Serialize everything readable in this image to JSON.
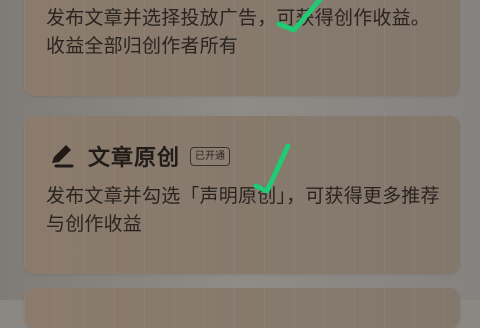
{
  "cards": {
    "top": {
      "description": "发布文章并选择投放广告，可获得创作收益。收益全部归创作者所有"
    },
    "original": {
      "title": "文章原创",
      "badge": "已开通",
      "description": "发布文章并勾选「声明原创」，可获得更多推荐与创作收益"
    }
  },
  "icons": {
    "pen": "pen-icon",
    "check": "check-mark-icon"
  },
  "colors": {
    "check": "#1fcb75",
    "card": "#8a7c6f",
    "text": "#2a2420"
  }
}
